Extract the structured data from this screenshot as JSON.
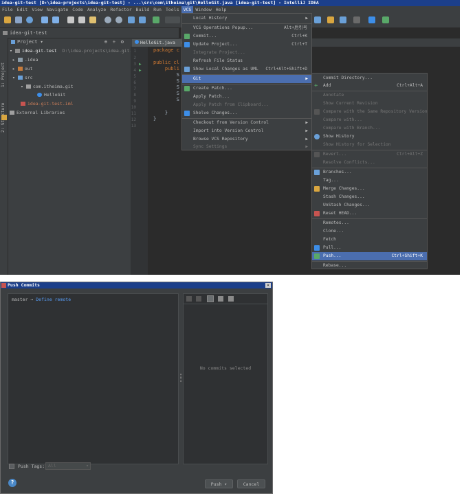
{
  "ide": {
    "title": "idea-git-test [D:\\idea-projects\\idea-git-test] - ...\\src\\com\\itheima\\git\\HelloGit.java [idea-git-test] - IntelliJ IDEA",
    "menus": [
      "File",
      "Edit",
      "View",
      "Navigate",
      "Code",
      "Analyze",
      "Refactor",
      "Build",
      "Run",
      "Tools",
      "VCS",
      "Window",
      "Help"
    ],
    "breadcrumb": "idea-git-test",
    "side_tabs": [
      "1: Project",
      "2: Structure"
    ],
    "project_header": "Project",
    "tree": [
      {
        "label": "idea-git-test",
        "suffix": "D:\\idea-projects\\idea-git-t",
        "level": 0
      },
      {
        "label": ".idea",
        "level": 1
      },
      {
        "label": "out",
        "level": 1
      },
      {
        "label": "src",
        "level": 1
      },
      {
        "label": "com.itheima.git",
        "level": 2
      },
      {
        "label": "HelloGit",
        "level": 3
      },
      {
        "label": "idea-git-test.iml",
        "level": 1
      },
      {
        "label": "External Libraries",
        "level": 0
      }
    ],
    "editor_tab": "HelloGit.java",
    "line_numbers": [
      "1",
      "2",
      "3",
      "4",
      "5",
      "6",
      "7",
      "8",
      "9",
      "10",
      "11",
      "12",
      "13"
    ],
    "code_lines": [
      "package c",
      "",
      "public cl",
      "    publi",
      "        S",
      "        S",
      "        S",
      "        S",
      "        S",
      "    }",
      "}",
      "",
      ""
    ]
  },
  "vcs_menu": {
    "items": [
      {
        "label": "Local History",
        "arrow": true
      },
      {
        "label": "VCS Operations Popup...",
        "shortcut": "Alt+后引号"
      },
      {
        "label": "Commit...",
        "shortcut": "Ctrl+K"
      },
      {
        "label": "Update Project...",
        "shortcut": "Ctrl+T"
      },
      {
        "label": "Integrate Project...",
        "disabled": true
      },
      {
        "label": "Refresh File Status"
      },
      {
        "label": "Show Local Changes as UML",
        "shortcut": "Ctrl+Alt+Shift+D"
      },
      {
        "label": "Git",
        "arrow": true,
        "highlighted": true
      },
      {
        "label": "Create Patch..."
      },
      {
        "label": "Apply Patch..."
      },
      {
        "label": "Apply Patch from Clipboard...",
        "disabled": true
      },
      {
        "label": "Shelve Changes..."
      },
      {
        "label": "Checkout from Version Control",
        "arrow": true
      },
      {
        "label": "Import into Version Control",
        "arrow": true
      },
      {
        "label": "Browse VCS Repository",
        "arrow": true
      },
      {
        "label": "Sync Settings",
        "arrow": true,
        "disabled": true
      }
    ]
  },
  "git_menu": {
    "items": [
      {
        "label": "Commit Directory..."
      },
      {
        "label": "Add",
        "shortcut": "Ctrl+Alt+A"
      },
      {
        "label": "Annotate",
        "disabled": true
      },
      {
        "label": "Show Current Revision",
        "disabled": true
      },
      {
        "label": "Compare with the Same Repository Version",
        "disabled": true
      },
      {
        "label": "Compare with...",
        "disabled": true
      },
      {
        "label": "Compare with Branch...",
        "disabled": true
      },
      {
        "label": "Show History"
      },
      {
        "label": "Show History for Selection",
        "disabled": true
      },
      {
        "label": "Revert...",
        "shortcut": "Ctrl+Alt+Z",
        "disabled": true
      },
      {
        "label": "Resolve Conflicts...",
        "disabled": true
      },
      {
        "label": "Branches..."
      },
      {
        "label": "Tag..."
      },
      {
        "label": "Merge Changes..."
      },
      {
        "label": "Stash Changes..."
      },
      {
        "label": "UnStash Changes..."
      },
      {
        "label": "Reset HEAD..."
      },
      {
        "label": "Remotes..."
      },
      {
        "label": "Clone..."
      },
      {
        "label": "Fetch"
      },
      {
        "label": "Pull..."
      },
      {
        "label": "Push...",
        "shortcut": "Ctrl+Shift+K",
        "highlighted": true
      },
      {
        "label": "Rebase..."
      }
    ]
  },
  "dialog": {
    "title": "Push Commits",
    "close": "×",
    "branch": "master",
    "arrow": "→",
    "define_remote": "Define remote",
    "no_commits": "No commits selected",
    "push_tags_label": "Push Tags:",
    "push_tags_value": "All",
    "help": "?",
    "push_button": "Push ▾",
    "cancel_button": "Cancel"
  }
}
